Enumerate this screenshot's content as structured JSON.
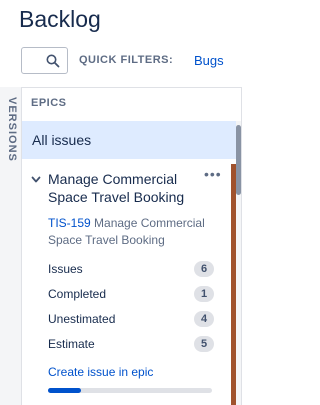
{
  "page": {
    "title": "Backlog"
  },
  "toolbar": {
    "search_icon": "search-icon",
    "quick_filters_label": "QUICK FILTERS:",
    "quick_filter_bugs": "Bugs"
  },
  "side_tab": {
    "label": "VERSIONS"
  },
  "epics_panel": {
    "heading": "EPICS",
    "all_issues_label": "All issues",
    "epic": {
      "title": "Manage Commercial Space Travel Booking",
      "more_label": "•••",
      "key": "TIS-159",
      "summary": "Manage Commercial Space Travel Booking",
      "color": "#a0522d",
      "stats": [
        {
          "label": "Issues",
          "value": "6"
        },
        {
          "label": "Completed",
          "value": "1"
        },
        {
          "label": "Unestimated",
          "value": "4"
        },
        {
          "label": "Estimate",
          "value": "5"
        }
      ],
      "create_link": "Create issue in epic",
      "progress_fraction": 0.2
    }
  },
  "colors": {
    "accent": "#0052cc",
    "selected_bg": "#deebff",
    "epic_stripe": "#a0522d"
  }
}
